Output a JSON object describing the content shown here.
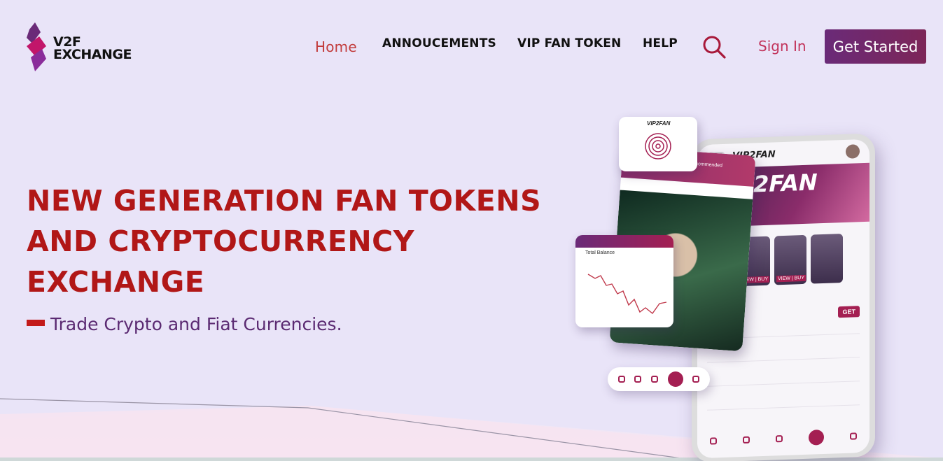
{
  "brand": {
    "line1": "V2F",
    "line2": "EXCHANGE"
  },
  "nav": {
    "home": "Home",
    "announcements": "ANNOUCEMENTS",
    "vip_fan_token": "VIP FAN TOKEN",
    "help": "HELP"
  },
  "auth": {
    "sign_in": "Sign In",
    "get_started": "Get Started"
  },
  "hero": {
    "title_lines": [
      "NEW GENERATION FAN TOKENS",
      "AND CRYPTOCURRENCY",
      "EXCHANGE"
    ],
    "subtitle": "Trade Crypto and Fiat Currencies."
  },
  "mockup": {
    "app_logo": "VIP2FAN",
    "banner_text": "VIP2FAN",
    "recommended": "Recommended",
    "total_balance": "Total Balance",
    "get_label": "GET",
    "card_tag": "VIEW | BUY"
  },
  "colors": {
    "accent_red": "#b11717",
    "brand_purple": "#6a2a78",
    "nav_active": "#c23b3b",
    "sign_in": "#c2335b",
    "background": "#e9e4f8"
  }
}
